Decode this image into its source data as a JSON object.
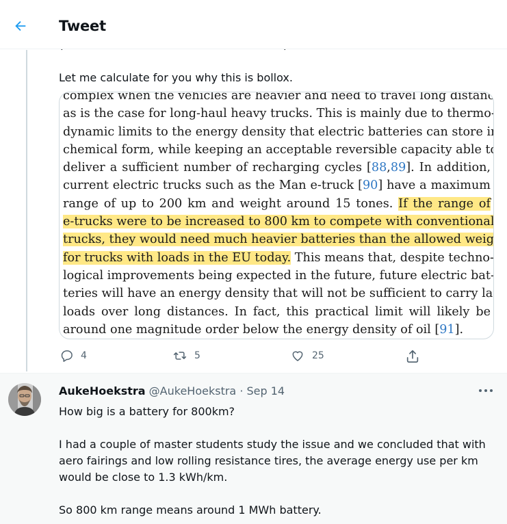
{
  "header": {
    "title": "Tweet",
    "back_icon": "arrow-left-icon",
    "accent": "#1d9bf0"
  },
  "main_tweet": {
    "text": "Let me calculate for you why this is bollox.",
    "image": {
      "lines": [
        [
          {
            "t": "complex when the vehicles are heavier and need to travel long distances,"
          }
        ],
        [
          {
            "t": "as is the case for long-haul heavy trucks. This is mainly due to thermo-"
          }
        ],
        [
          {
            "t": "dynamic limits to the energy density that electric batteries can store in"
          }
        ],
        [
          {
            "t": "chemical form, while keeping an acceptable reversible capacity able to"
          }
        ],
        [
          {
            "t": "deliver a sufficient number of recharging cycles ["
          },
          {
            "t": "88",
            "ref": true
          },
          {
            "t": ","
          },
          {
            "t": "89",
            "ref": true
          },
          {
            "t": "]. In addition,"
          }
        ],
        [
          {
            "t": "current electric trucks such as the Man e-truck ["
          },
          {
            "t": "90",
            "ref": true
          },
          {
            "t": "] have a maximum"
          }
        ],
        [
          {
            "t": "range of up to 200 km and weight around 15 tones. "
          },
          {
            "t": "If the range of",
            "hl": true
          }
        ],
        [
          {
            "t": "e-trucks were to be increased to 800 km to compete with conventional",
            "hl": true
          }
        ],
        [
          {
            "t": "trucks, they would need much heavier batteries than the allowed weight",
            "hl": true
          }
        ],
        [
          {
            "t": "for trucks with loads in the EU today.",
            "hl": true
          },
          {
            "t": " This means that, despite techno-"
          }
        ],
        [
          {
            "t": "logical improvements being expected in the future, future electric bat-"
          }
        ],
        [
          {
            "t": "teries will have an energy density that will not be sufficient to carry large"
          }
        ],
        [
          {
            "t": "loads over long distances. In fact, this practical limit will likely be"
          }
        ],
        [
          {
            "t": "around one magnitude order below the energy density of oil ["
          },
          {
            "t": "91",
            "ref": true
          },
          {
            "t": "]."
          }
        ]
      ],
      "highlight_color": "#ffe886",
      "reference_color": "#2f78c4"
    },
    "actions": {
      "reply_count": "4",
      "retweet_count": "5",
      "like_count": "25",
      "icons": [
        "reply-icon",
        "retweet-icon",
        "like-icon",
        "share-icon"
      ]
    }
  },
  "reply": {
    "author_name": "AukeHoekstra",
    "handle": "@AukeHoekstra",
    "separator": "·",
    "date": "Sep 14",
    "more_icon": "more-icon",
    "paragraphs": [
      "How big is a battery for 800km?",
      "I had a couple of master students study the issue and we concluded that with aero fairings and low rolling resistance tires, the average energy use per km would be close to 1.3 kWh/km.",
      "So 800 km range means around 1 MWh battery."
    ]
  }
}
